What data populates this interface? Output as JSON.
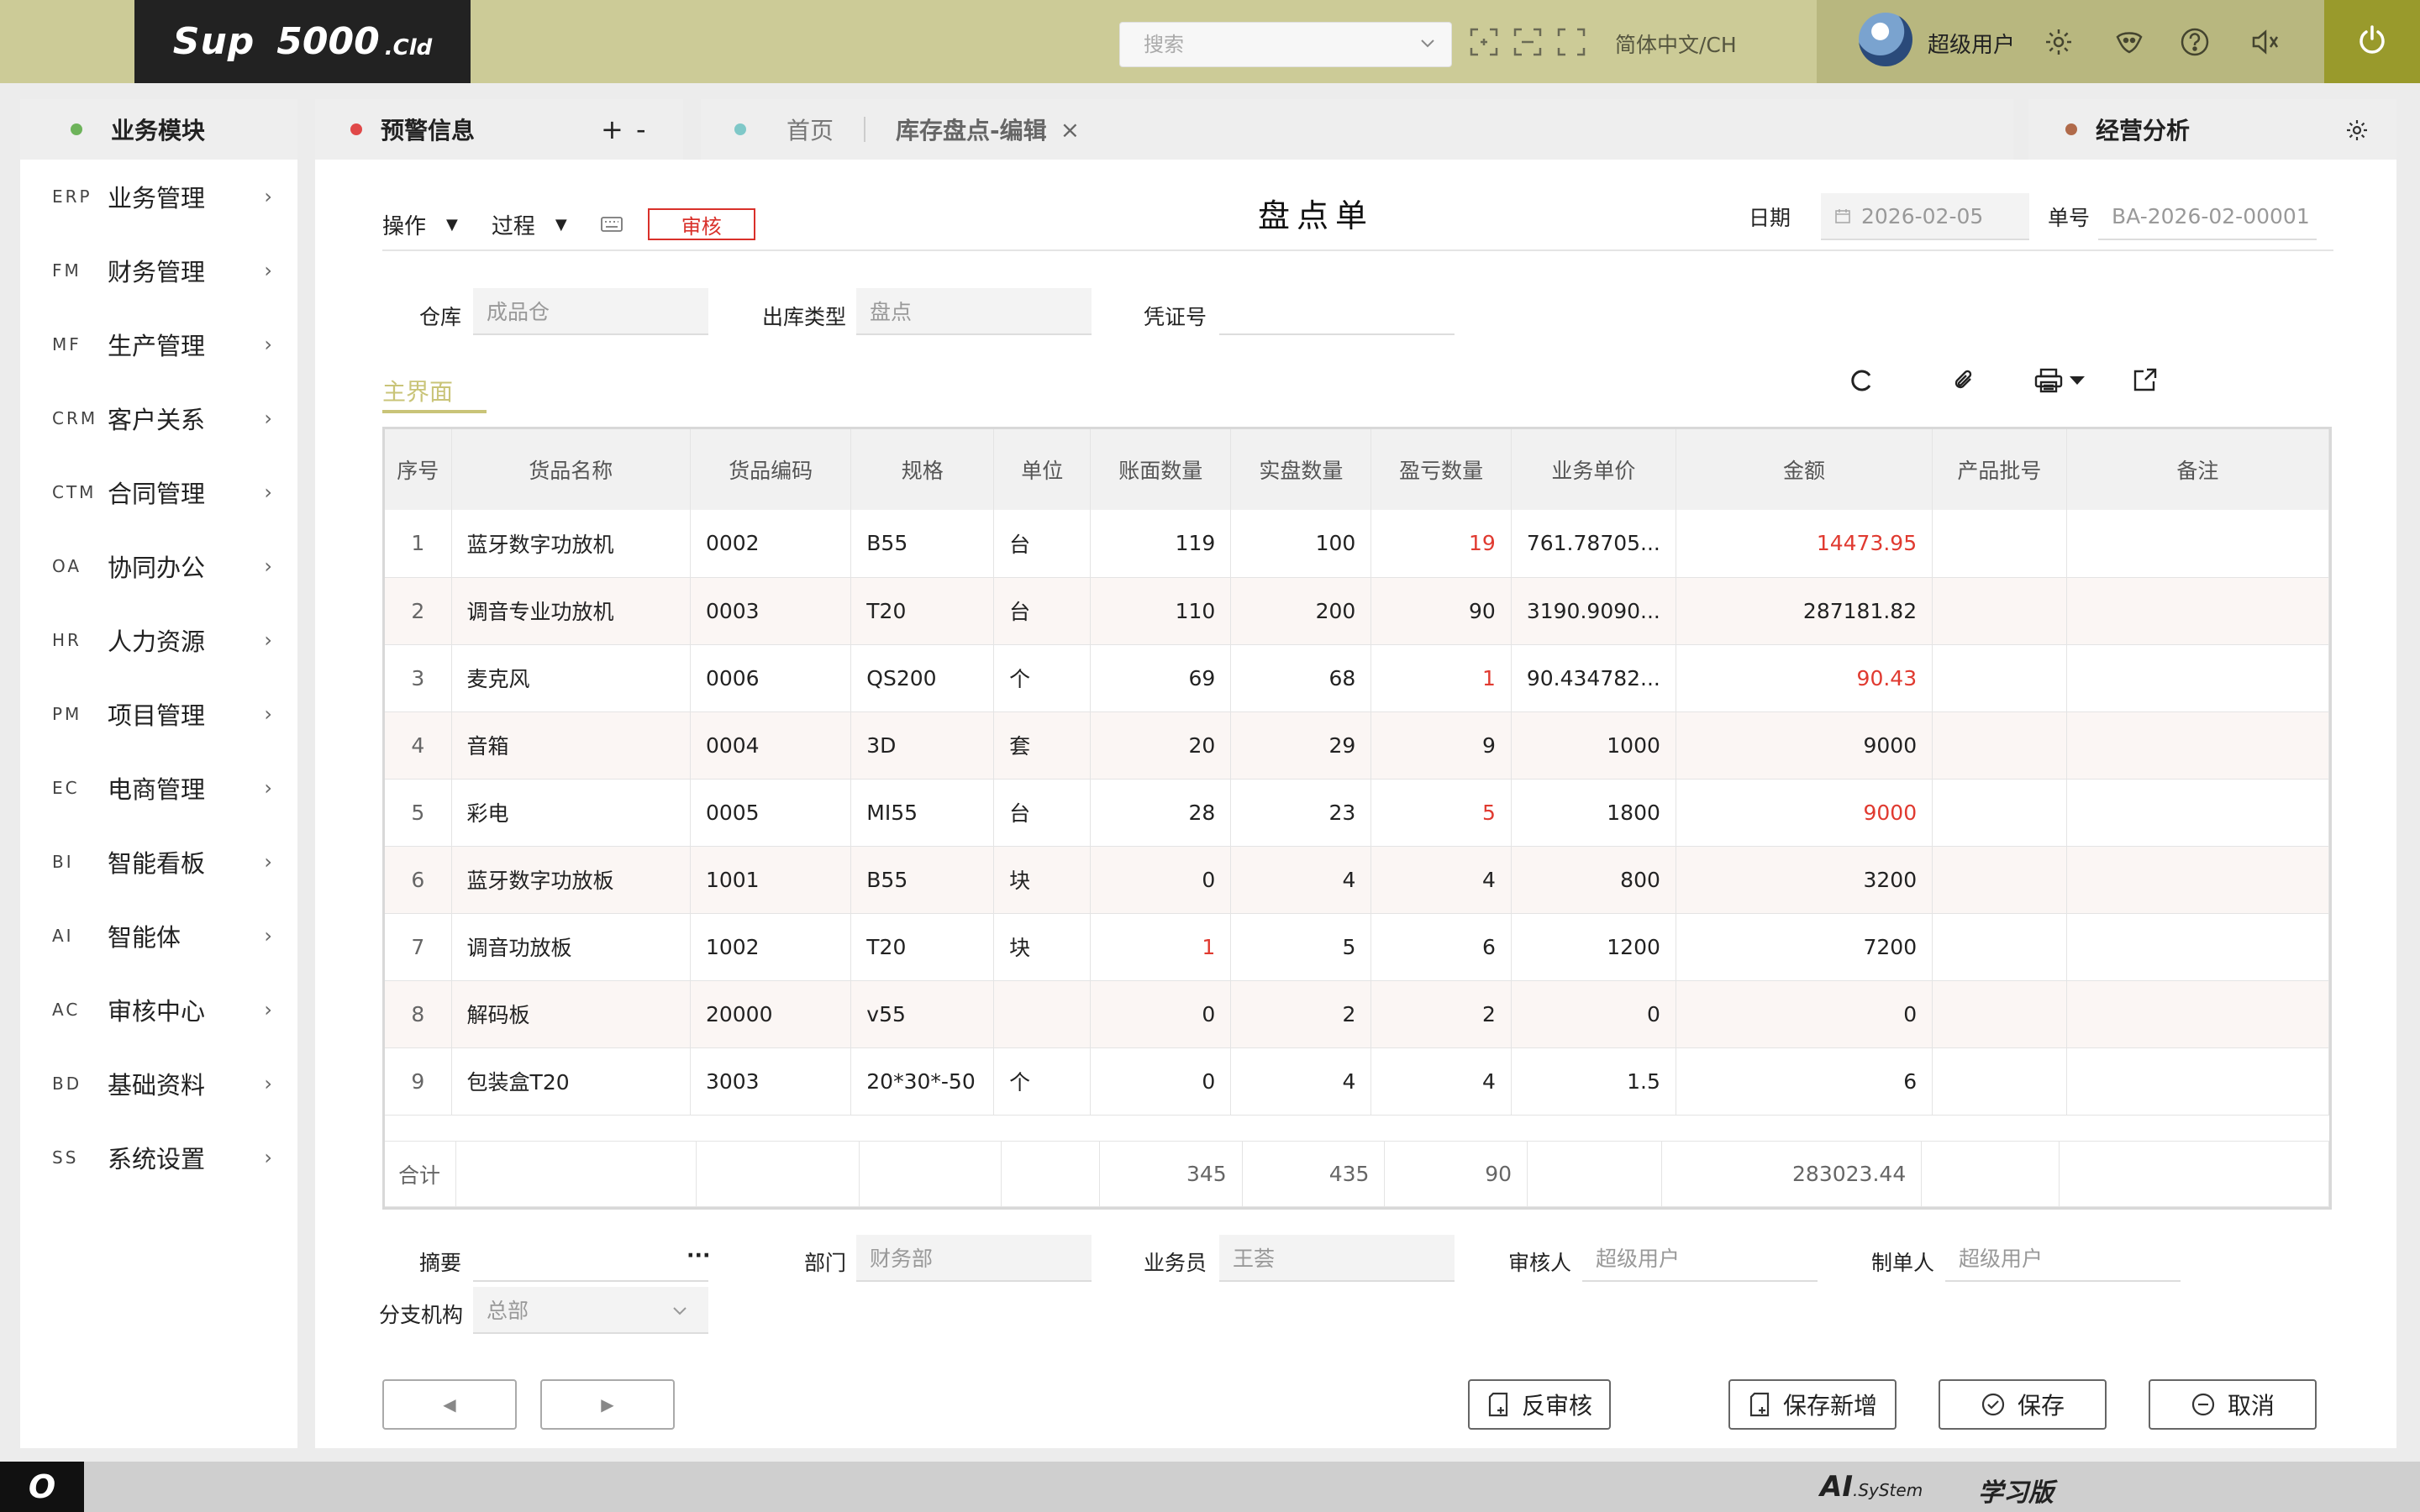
{
  "header": {
    "logo_brand": "Sup",
    "logo_num": "5000",
    "logo_suffix": ".Cld",
    "search_placeholder": "搜索",
    "language": "简体中文/CH",
    "username": "超级用户"
  },
  "sidebar": {
    "title": "业务模块",
    "items": [
      {
        "code": "ERP",
        "label": "业务管理"
      },
      {
        "code": "FM",
        "label": "财务管理"
      },
      {
        "code": "MF",
        "label": "生产管理"
      },
      {
        "code": "CRM",
        "label": "客户关系"
      },
      {
        "code": "CTM",
        "label": "合同管理"
      },
      {
        "code": "OA",
        "label": "协同办公"
      },
      {
        "code": "HR",
        "label": "人力资源"
      },
      {
        "code": "PM",
        "label": "项目管理"
      },
      {
        "code": "EC",
        "label": "电商管理"
      },
      {
        "code": "BI",
        "label": "智能看板"
      },
      {
        "code": "AI",
        "label": "智能体"
      },
      {
        "code": "AC",
        "label": "审核中心"
      },
      {
        "code": "BD",
        "label": "基础资料"
      },
      {
        "code": "SS",
        "label": "系统设置"
      }
    ]
  },
  "alerts_tab": {
    "label": "预警信息",
    "plus": "+",
    "minus": "-"
  },
  "tabs": {
    "home": "首页",
    "active": "库存盘点-编辑",
    "close": "×"
  },
  "analysis_tab": {
    "label": "经营分析"
  },
  "toolbar": {
    "operate": "操作",
    "process": "过程",
    "audit": "审核"
  },
  "document": {
    "title": "盘点单",
    "date_label": "日期",
    "date_value": "2026-02-05",
    "number_label": "单号",
    "number_value": "BA-2026-02-00001",
    "warehouse_label": "仓库",
    "warehouse_value": "成品仓",
    "out_type_label": "出库类型",
    "out_type_value": "盘点",
    "voucher_label": "凭证号",
    "voucher_value": ""
  },
  "subtab": "主界面",
  "table": {
    "columns": [
      "序号",
      "货品名称",
      "货品编码",
      "规格",
      "单位",
      "账面数量",
      "实盘数量",
      "盈亏数量",
      "业务单价",
      "金额",
      "产品批号",
      "备注"
    ],
    "rows": [
      {
        "no": "1",
        "name": "蓝牙数字功放机",
        "code": "0002",
        "spec": "B55",
        "unit": "台",
        "book": "119",
        "actual": "100",
        "diff": "19",
        "price": "761.78705...",
        "amount": "14473.95",
        "batch": "",
        "note": ""
      },
      {
        "no": "2",
        "name": "调音专业功放机",
        "code": "0003",
        "spec": "T20",
        "unit": "台",
        "book": "110",
        "actual": "200",
        "diff": "90",
        "price": "3190.9090...",
        "amount": "287181.82",
        "batch": "",
        "note": ""
      },
      {
        "no": "3",
        "name": "麦克风",
        "code": "0006",
        "spec": "QS200",
        "unit": "个",
        "book": "69",
        "actual": "68",
        "diff": "1",
        "price": "90.434782...",
        "amount": "90.43",
        "batch": "",
        "note": ""
      },
      {
        "no": "4",
        "name": "音箱",
        "code": "0004",
        "spec": "3D",
        "unit": "套",
        "book": "20",
        "actual": "29",
        "diff": "9",
        "price": "1000",
        "amount": "9000",
        "batch": "",
        "note": ""
      },
      {
        "no": "5",
        "name": "彩电",
        "code": "0005",
        "spec": "MI55",
        "unit": "台",
        "book": "28",
        "actual": "23",
        "diff": "5",
        "price": "1800",
        "amount": "9000",
        "batch": "",
        "note": ""
      },
      {
        "no": "6",
        "name": "蓝牙数字功放板",
        "code": "1001",
        "spec": "B55",
        "unit": "块",
        "book": "0",
        "actual": "4",
        "diff": "4",
        "price": "800",
        "amount": "3200",
        "batch": "",
        "note": ""
      },
      {
        "no": "7",
        "name": "调音功放板",
        "code": "1002",
        "spec": "T20",
        "unit": "块",
        "book": "1",
        "actual": "5",
        "diff": "6",
        "price": "1200",
        "amount": "7200",
        "batch": "",
        "note": ""
      },
      {
        "no": "8",
        "name": "解码板",
        "code": "20000",
        "spec": "v55",
        "unit": "",
        "book": "0",
        "actual": "2",
        "diff": "2",
        "price": "0",
        "amount": "0",
        "batch": "",
        "note": ""
      },
      {
        "no": "9",
        "name": "包装盒T20",
        "code": "3003",
        "spec": "20*30*-50",
        "unit": "个",
        "book": "0",
        "actual": "4",
        "diff": "4",
        "price": "1.5",
        "amount": "6",
        "batch": "",
        "note": ""
      }
    ],
    "total": {
      "label": "合计",
      "book": "345",
      "actual": "435",
      "diff": "90",
      "amount": "283023.44"
    }
  },
  "footer_fields": {
    "summary_label": "摘要",
    "summary_value": "",
    "summary_more": "···",
    "dept_label": "部门",
    "dept_value": "财务部",
    "clerk_label": "业务员",
    "clerk_value": "王荟",
    "auditor_label": "审核人",
    "auditor_value": "超级用户",
    "maker_label": "制单人",
    "maker_value": "超级用户",
    "branch_label": "分支机构",
    "branch_value": "总部"
  },
  "buttons": {
    "prev": "◀",
    "next": "▶",
    "unaudit": "反审核",
    "save_new": "保存新增",
    "save": "保存",
    "cancel": "取消"
  },
  "footer": {
    "badge": "O",
    "ai_brand": "AI",
    "ai_system": ".SyStem",
    "edition": "学习版"
  },
  "colors": {
    "topbar": "#cccb97",
    "userzone": "#b8b77f",
    "power": "#999a2c",
    "accent_red": "#e03a30",
    "subtab_accent": "#c9c478",
    "dot_green": "#6db35a",
    "dot_red": "#e04848",
    "dot_teal": "#7fc8c8",
    "dot_brown": "#b06a4a"
  }
}
